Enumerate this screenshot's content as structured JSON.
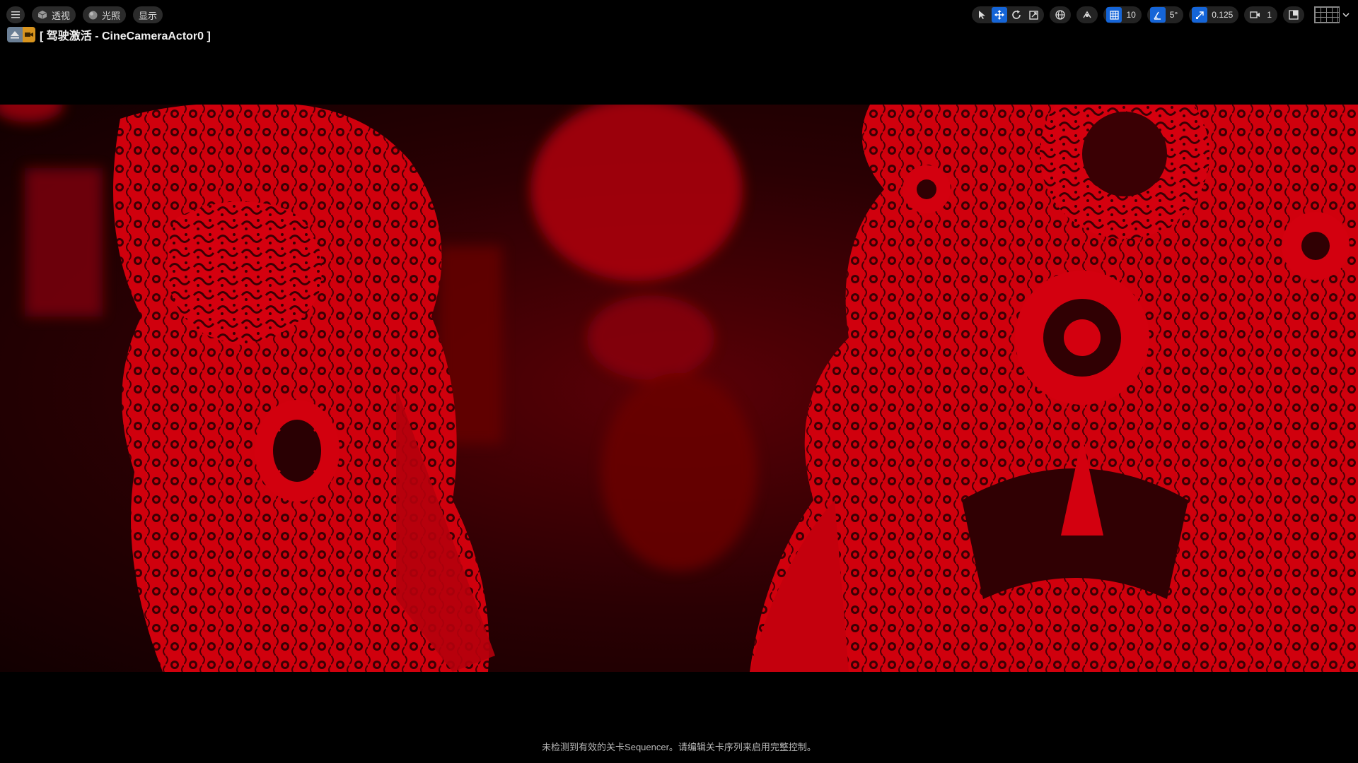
{
  "toolbar": {
    "menu_icon": "hamburger-icon",
    "perspective_label": "透视",
    "lighting_label": "光照",
    "show_label": "显示"
  },
  "pilot": {
    "title": "[ 驾驶激活 - CineCameraActor0 ]"
  },
  "viewport_tools": {
    "grid_snap_value": "10",
    "rotation_snap_value": "5°",
    "scale_snap_value": "0.125",
    "camera_speed_value": "1"
  },
  "footer": {
    "message": "未检测到有效的关卡Sequencer。请编辑关卡序列来启用完整控制。"
  },
  "colors": {
    "accent": "#1565d8",
    "papercut_red": "#d4000e",
    "pilot_icon_orange": "#d8941e"
  }
}
